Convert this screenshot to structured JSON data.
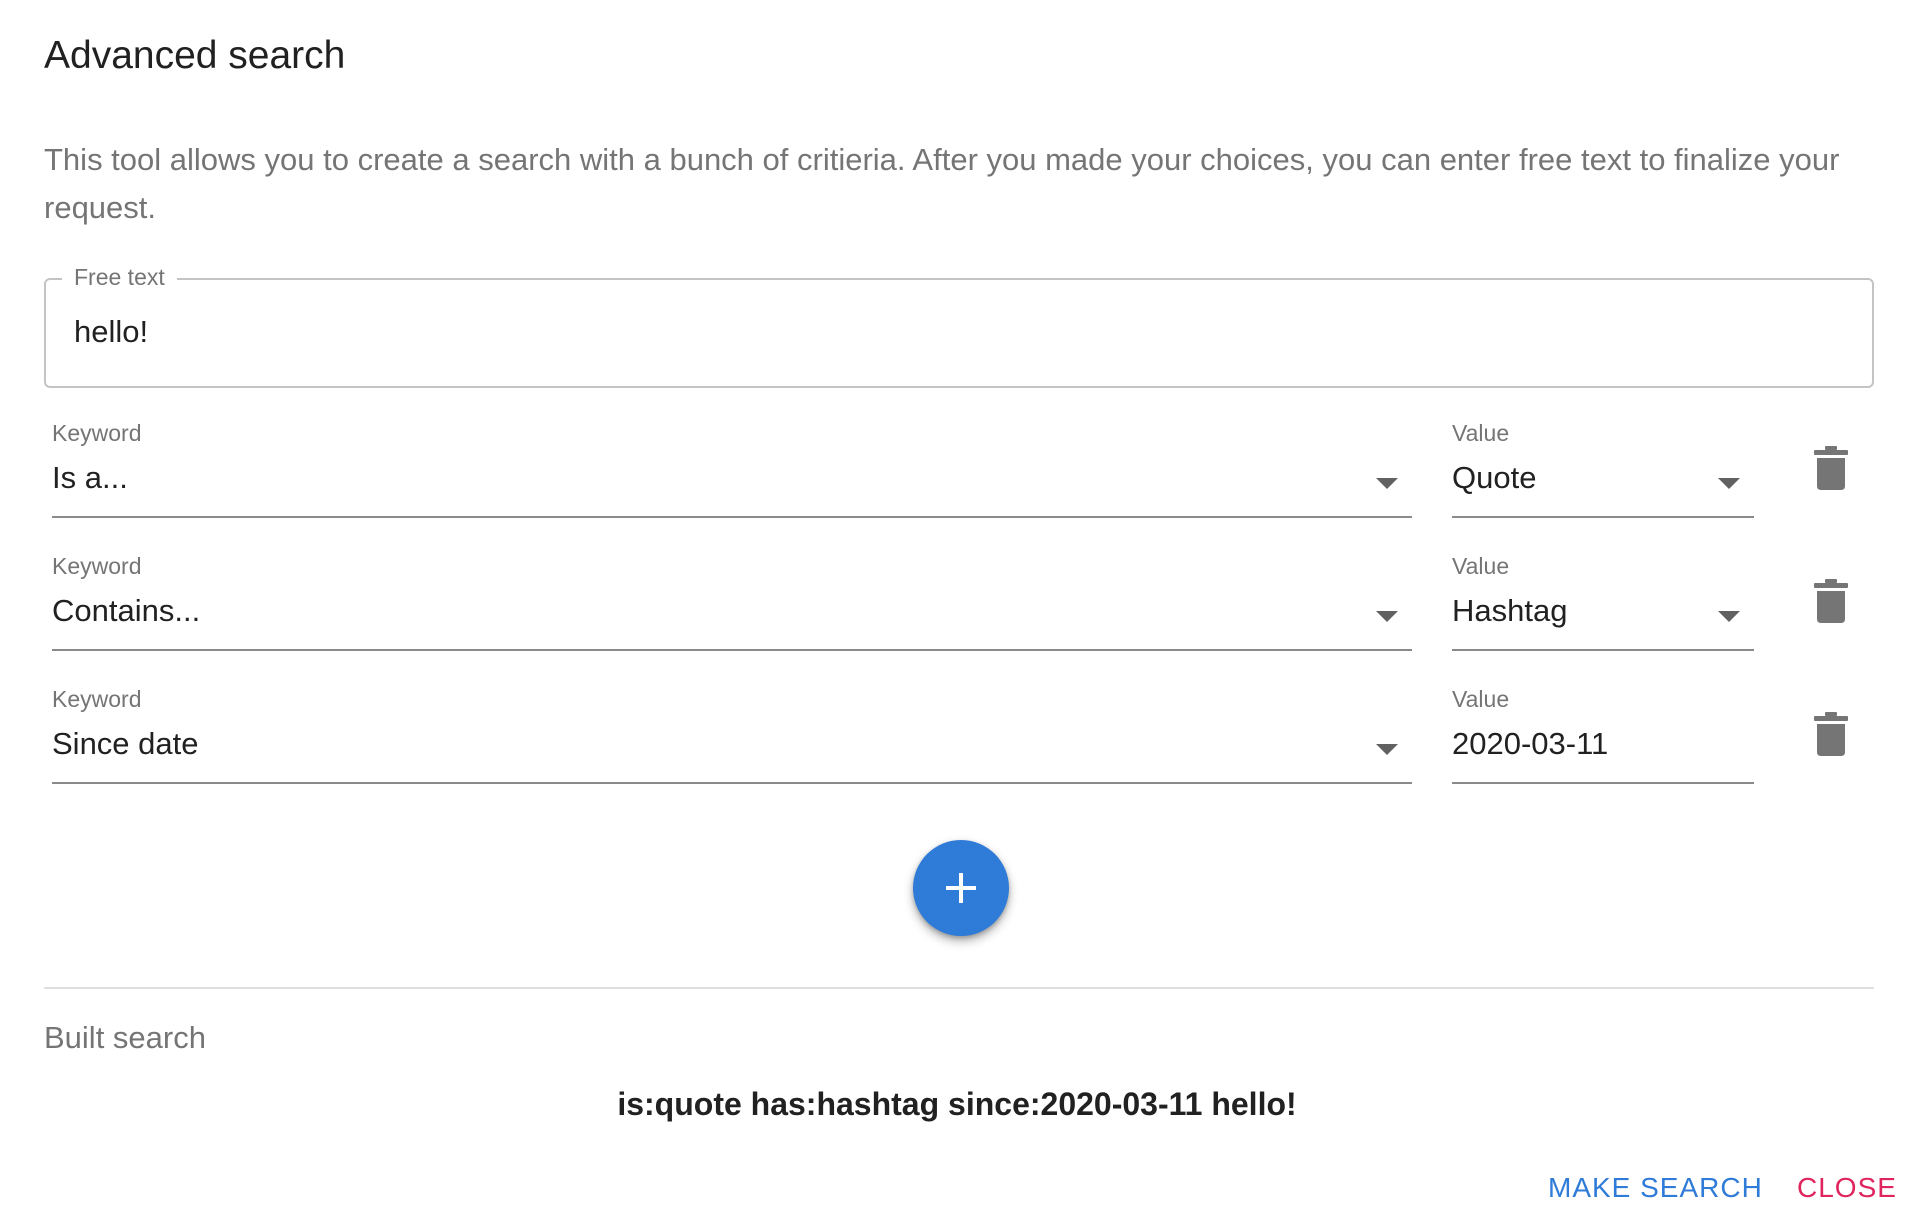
{
  "dialog": {
    "title": "Advanced search",
    "description": "This tool allows you to create a search with a bunch of critieria. After you made your choices, you can enter free text to finalize your request."
  },
  "free_text": {
    "label": "Free text",
    "value": "hello!"
  },
  "criteria": [
    {
      "keyword_label": "Keyword",
      "keyword_value": "Is a...",
      "value_label": "Value",
      "value": "Quote",
      "value_is_select": true,
      "delete_icon": "trash-icon"
    },
    {
      "keyword_label": "Keyword",
      "keyword_value": "Contains...",
      "value_label": "Value",
      "value": "Hashtag",
      "value_is_select": true,
      "delete_icon": "trash-icon"
    },
    {
      "keyword_label": "Keyword",
      "keyword_value": "Since date",
      "value_label": "Value",
      "value": "2020-03-11",
      "value_is_select": false,
      "delete_icon": "trash-icon"
    }
  ],
  "add_button": {
    "icon": "plus-icon"
  },
  "built": {
    "label": "Built search",
    "query": "is:quote has:hashtag since:2020-03-11 hello!"
  },
  "actions": {
    "make_search": "MAKE SEARCH",
    "close": "CLOSE"
  },
  "colors": {
    "primary": "#2f7bd8",
    "secondary": "#e0245e",
    "text": "#212121",
    "muted": "#757575"
  }
}
